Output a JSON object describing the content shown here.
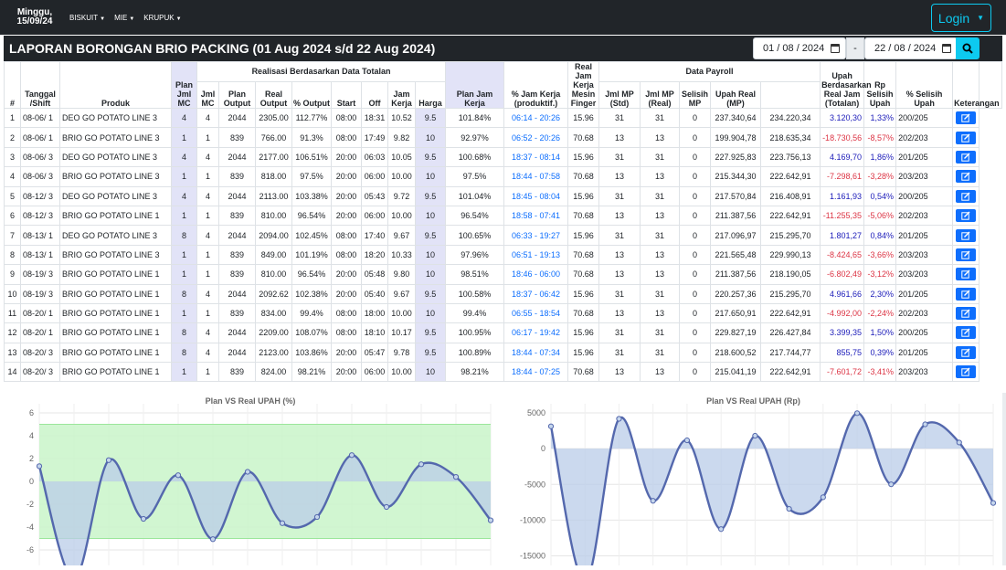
{
  "navbar": {
    "brand_line1": "Minggu,",
    "brand_line2": "15/09/24",
    "menus": [
      "BISKUIT",
      "MIE",
      "KRUPUK"
    ],
    "login_label": "Login"
  },
  "report": {
    "title": "LAPORAN BORONGAN BRIO PACKING (01 Aug 2024 s/d 22 Aug 2024)",
    "date_from": "01 / 08 / 2024",
    "date_sep": "-",
    "date_to": "22 / 08 / 2024"
  },
  "table": {
    "group_headers": {
      "realisasi": "Realisasi Berdasarkan Data Totalan",
      "payroll": "Data Payroll"
    },
    "headers": {
      "no": "#",
      "tanggal": "Tanggal /Shift",
      "produk": "Produk",
      "plan_jml_mc": "Plan Jml MC",
      "jml_mc": "Jml MC",
      "plan_output": "Plan Output",
      "real_output": "Real Output",
      "pct_output": "% Output",
      "start": "Start",
      "off": "Off",
      "jam_kerja": "Jam Kerja",
      "plan_jam_kerja": "Plan Jam Kerja",
      "pct_jam_kerja": "% Jam Kerja (produktif.)",
      "real_jam_finger": "Real Jam Kerja Mesin Finger",
      "harga": "Harga",
      "jml_mp_std": "Jml MP (Std)",
      "jml_mp_real": "Jml MP (Real)",
      "selisih_mp": "Selisih MP",
      "upah_real": "Upah Real (MP)",
      "upah_real_jam": "Upah Berdasarkan Real Jam (Totalan)",
      "rp_selisih": "Rp Selisih Upah",
      "pct_selisih": "% Selisih Upah",
      "keterangan": "Keterangan"
    },
    "rows": [
      {
        "no": "1",
        "tgl": "08-06/ 1",
        "produk": "DEO GO POTATO LINE 3",
        "plan_mc": "4",
        "mc": "4",
        "plan_out": "2044",
        "real_out": "2305.00",
        "pct_out": "112.77%",
        "start": "08:00",
        "off": "18:31",
        "jam": "10.52",
        "plan_jam": "9.5",
        "pct_jam": "101.84%",
        "finger": "06:14 - 20:26",
        "harga": "15.96",
        "mp_std": "31",
        "mp_real": "31",
        "sel_mp": "0",
        "upah_real": "237.340,64",
        "upah_jam": "234.220,34",
        "rp_sel": "3.120,30",
        "pct_sel": "1,33%",
        "ket": "200/205",
        "neg": false
      },
      {
        "no": "2",
        "tgl": "08-06/ 1",
        "produk": "BRIO GO POTATO LINE 3",
        "plan_mc": "1",
        "mc": "1",
        "plan_out": "839",
        "real_out": "766.00",
        "pct_out": "91.3%",
        "start": "08:00",
        "off": "17:49",
        "jam": "9.82",
        "plan_jam": "10",
        "pct_jam": "92.97%",
        "finger": "06:52 - 20:26",
        "harga": "70.68",
        "mp_std": "13",
        "mp_real": "13",
        "sel_mp": "0",
        "upah_real": "199.904,78",
        "upah_jam": "218.635,34",
        "rp_sel": "-18.730,56",
        "pct_sel": "-8,57%",
        "ket": "202/203",
        "neg": true
      },
      {
        "no": "3",
        "tgl": "08-06/ 3",
        "produk": "DEO GO POTATO LINE 3",
        "plan_mc": "4",
        "mc": "4",
        "plan_out": "2044",
        "real_out": "2177.00",
        "pct_out": "106.51%",
        "start": "20:00",
        "off": "06:03",
        "jam": "10.05",
        "plan_jam": "9.5",
        "pct_jam": "100.68%",
        "finger": "18:37 - 08:14",
        "harga": "15.96",
        "mp_std": "31",
        "mp_real": "31",
        "sel_mp": "0",
        "upah_real": "227.925,83",
        "upah_jam": "223.756,13",
        "rp_sel": "4.169,70",
        "pct_sel": "1,86%",
        "ket": "201/205",
        "neg": false
      },
      {
        "no": "4",
        "tgl": "08-06/ 3",
        "produk": "BRIO GO POTATO LINE 3",
        "plan_mc": "1",
        "mc": "1",
        "plan_out": "839",
        "real_out": "818.00",
        "pct_out": "97.5%",
        "start": "20:00",
        "off": "06:00",
        "jam": "10.00",
        "plan_jam": "10",
        "pct_jam": "97.5%",
        "finger": "18:44 - 07:58",
        "harga": "70.68",
        "mp_std": "13",
        "mp_real": "13",
        "sel_mp": "0",
        "upah_real": "215.344,30",
        "upah_jam": "222.642,91",
        "rp_sel": "-7.298,61",
        "pct_sel": "-3,28%",
        "ket": "203/203",
        "neg": true
      },
      {
        "no": "5",
        "tgl": "08-12/ 3",
        "produk": "DEO GO POTATO LINE 3",
        "plan_mc": "4",
        "mc": "4",
        "plan_out": "2044",
        "real_out": "2113.00",
        "pct_out": "103.38%",
        "start": "20:00",
        "off": "05:43",
        "jam": "9.72",
        "plan_jam": "9.5",
        "pct_jam": "101.04%",
        "finger": "18:45 - 08:04",
        "harga": "15.96",
        "mp_std": "31",
        "mp_real": "31",
        "sel_mp": "0",
        "upah_real": "217.570,84",
        "upah_jam": "216.408,91",
        "rp_sel": "1.161,93",
        "pct_sel": "0,54%",
        "ket": "200/205",
        "neg": false
      },
      {
        "no": "6",
        "tgl": "08-12/ 3",
        "produk": "BRIO GO POTATO LINE 1",
        "plan_mc": "1",
        "mc": "1",
        "plan_out": "839",
        "real_out": "810.00",
        "pct_out": "96.54%",
        "start": "20:00",
        "off": "06:00",
        "jam": "10.00",
        "plan_jam": "10",
        "pct_jam": "96.54%",
        "finger": "18:58 - 07:41",
        "harga": "70.68",
        "mp_std": "13",
        "mp_real": "13",
        "sel_mp": "0",
        "upah_real": "211.387,56",
        "upah_jam": "222.642,91",
        "rp_sel": "-11.255,35",
        "pct_sel": "-5,06%",
        "ket": "202/203",
        "neg": true
      },
      {
        "no": "7",
        "tgl": "08-13/ 1",
        "produk": "DEO GO POTATO LINE 3",
        "plan_mc": "8",
        "mc": "4",
        "plan_out": "2044",
        "real_out": "2094.00",
        "pct_out": "102.45%",
        "start": "08:00",
        "off": "17:40",
        "jam": "9.67",
        "plan_jam": "9.5",
        "pct_jam": "100.65%",
        "finger": "06:33 - 19:27",
        "harga": "15.96",
        "mp_std": "31",
        "mp_real": "31",
        "sel_mp": "0",
        "upah_real": "217.096,97",
        "upah_jam": "215.295,70",
        "rp_sel": "1.801,27",
        "pct_sel": "0,84%",
        "ket": "201/205",
        "neg": false
      },
      {
        "no": "8",
        "tgl": "08-13/ 1",
        "produk": "BRIO GO POTATO LINE 3",
        "plan_mc": "1",
        "mc": "1",
        "plan_out": "839",
        "real_out": "849.00",
        "pct_out": "101.19%",
        "start": "08:00",
        "off": "18:20",
        "jam": "10.33",
        "plan_jam": "10",
        "pct_jam": "97.96%",
        "finger": "06:51 - 19:13",
        "harga": "70.68",
        "mp_std": "13",
        "mp_real": "13",
        "sel_mp": "0",
        "upah_real": "221.565,48",
        "upah_jam": "229.990,13",
        "rp_sel": "-8.424,65",
        "pct_sel": "-3,66%",
        "ket": "203/203",
        "neg": true
      },
      {
        "no": "9",
        "tgl": "08-19/ 3",
        "produk": "BRIO GO POTATO LINE 1",
        "plan_mc": "1",
        "mc": "1",
        "plan_out": "839",
        "real_out": "810.00",
        "pct_out": "96.54%",
        "start": "20:00",
        "off": "05:48",
        "jam": "9.80",
        "plan_jam": "10",
        "pct_jam": "98.51%",
        "finger": "18:46 - 06:00",
        "harga": "70.68",
        "mp_std": "13",
        "mp_real": "13",
        "sel_mp": "0",
        "upah_real": "211.387,56",
        "upah_jam": "218.190,05",
        "rp_sel": "-6.802,49",
        "pct_sel": "-3,12%",
        "ket": "203/203",
        "neg": true
      },
      {
        "no": "10",
        "tgl": "08-19/ 3",
        "produk": "BRIO GO POTATO LINE 1",
        "plan_mc": "8",
        "mc": "4",
        "plan_out": "2044",
        "real_out": "2092.62",
        "pct_out": "102.38%",
        "start": "20:00",
        "off": "05:40",
        "jam": "9.67",
        "plan_jam": "9.5",
        "pct_jam": "100.58%",
        "finger": "18:37 - 06:42",
        "harga": "15.96",
        "mp_std": "31",
        "mp_real": "31",
        "sel_mp": "0",
        "upah_real": "220.257,36",
        "upah_jam": "215.295,70",
        "rp_sel": "4.961,66",
        "pct_sel": "2,30%",
        "ket": "201/205",
        "neg": false
      },
      {
        "no": "11",
        "tgl": "08-20/ 1",
        "produk": "BRIO GO POTATO LINE 1",
        "plan_mc": "1",
        "mc": "1",
        "plan_out": "839",
        "real_out": "834.00",
        "pct_out": "99.4%",
        "start": "08:00",
        "off": "18:00",
        "jam": "10.00",
        "plan_jam": "10",
        "pct_jam": "99.4%",
        "finger": "06:55 - 18:54",
        "harga": "70.68",
        "mp_std": "13",
        "mp_real": "13",
        "sel_mp": "0",
        "upah_real": "217.650,91",
        "upah_jam": "222.642,91",
        "rp_sel": "-4.992,00",
        "pct_sel": "-2,24%",
        "ket": "202/203",
        "neg": true
      },
      {
        "no": "12",
        "tgl": "08-20/ 1",
        "produk": "BRIO GO POTATO LINE 1",
        "plan_mc": "8",
        "mc": "4",
        "plan_out": "2044",
        "real_out": "2209.00",
        "pct_out": "108.07%",
        "start": "08:00",
        "off": "18:10",
        "jam": "10.17",
        "plan_jam": "9.5",
        "pct_jam": "100.95%",
        "finger": "06:17 - 19:42",
        "harga": "15.96",
        "mp_std": "31",
        "mp_real": "31",
        "sel_mp": "0",
        "upah_real": "229.827,19",
        "upah_jam": "226.427,84",
        "rp_sel": "3.399,35",
        "pct_sel": "1,50%",
        "ket": "200/205",
        "neg": false
      },
      {
        "no": "13",
        "tgl": "08-20/ 3",
        "produk": "BRIO GO POTATO LINE 1",
        "plan_mc": "8",
        "mc": "4",
        "plan_out": "2044",
        "real_out": "2123.00",
        "pct_out": "103.86%",
        "start": "20:00",
        "off": "05:47",
        "jam": "9.78",
        "plan_jam": "9.5",
        "pct_jam": "100.89%",
        "finger": "18:44 - 07:34",
        "harga": "15.96",
        "mp_std": "31",
        "mp_real": "31",
        "sel_mp": "0",
        "upah_real": "218.600,52",
        "upah_jam": "217.744,77",
        "rp_sel": "855,75",
        "pct_sel": "0,39%",
        "ket": "201/205",
        "neg": false
      },
      {
        "no": "14",
        "tgl": "08-20/ 3",
        "produk": "BRIO GO POTATO LINE 1",
        "plan_mc": "1",
        "mc": "1",
        "plan_out": "839",
        "real_out": "824.00",
        "pct_out": "98.21%",
        "start": "20:00",
        "off": "06:00",
        "jam": "10.00",
        "plan_jam": "10",
        "pct_jam": "98.21%",
        "finger": "18:44 - 07:25",
        "harga": "70.68",
        "mp_std": "13",
        "mp_real": "13",
        "sel_mp": "0",
        "upah_real": "215.041,19",
        "upah_jam": "222.642,91",
        "rp_sel": "-7.601,72",
        "pct_sel": "-3,41%",
        "ket": "203/203",
        "neg": true
      }
    ]
  },
  "colors": {
    "navbar": "#212529",
    "accent": "#0dcaf0",
    "link_blue": "#0d6efd",
    "negative": "#dc3545",
    "line": "#5468ad",
    "fill_neg": "#c5d6ec",
    "band": "#ccf5cc"
  },
  "chart_data": [
    {
      "type": "line",
      "title": "Plan VS Real UPAH (%)",
      "ylim": [
        -8,
        6
      ],
      "yticks": [
        6,
        4,
        2,
        0,
        -2,
        -4,
        -6,
        -8
      ],
      "band": [
        -5,
        5
      ],
      "values": [
        1.33,
        -8.57,
        1.86,
        -3.28,
        0.54,
        -5.06,
        0.84,
        -3.66,
        -3.12,
        2.3,
        -2.24,
        1.5,
        0.39,
        -3.41
      ],
      "grid": true
    },
    {
      "type": "line",
      "title": "Plan VS Real UPAH (Rp)",
      "ylim": [
        -18000,
        5000
      ],
      "yticks": [
        5000,
        0,
        -5000,
        -10000,
        -15000
      ],
      "values": [
        3120.3,
        -18730.56,
        4169.7,
        -7298.61,
        1161.93,
        -11255.35,
        1801.27,
        -8424.65,
        -6802.49,
        4961.66,
        -4992.0,
        3399.35,
        855.75,
        -7601.72
      ],
      "grid": true
    }
  ]
}
